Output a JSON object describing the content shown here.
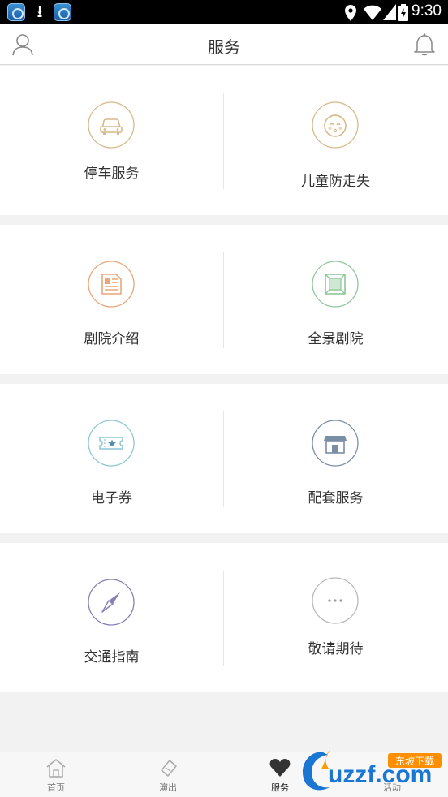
{
  "status_bar": {
    "time": "9:30",
    "icons": [
      "app-notification-icon",
      "download-icon",
      "app-notification-icon",
      "location-icon",
      "wifi-icon",
      "signal-icon",
      "battery-icon"
    ]
  },
  "header": {
    "title": "服务",
    "left_icon": "user-icon",
    "right_icon": "bell-icon"
  },
  "services": [
    {
      "label": "停车服务",
      "icon": "car-icon",
      "accent": "#d9b98a"
    },
    {
      "label": "儿童防走失",
      "icon": "baby-face-icon",
      "accent": "#d9b98a"
    },
    {
      "label": "剧院介绍",
      "icon": "document-icon",
      "accent": "#e9a678"
    },
    {
      "label": "全景剧院",
      "icon": "panorama-icon",
      "accent": "#8ec79a"
    },
    {
      "label": "电子券",
      "icon": "ticket-icon",
      "accent": "#8ec6d6"
    },
    {
      "label": "配套服务",
      "icon": "store-icon",
      "accent": "#7a8ea6"
    },
    {
      "label": "交通指南",
      "icon": "compass-icon",
      "accent": "#8a7fb5"
    },
    {
      "label": "敬请期待",
      "icon": "more-icon",
      "accent": "#b8b8b8"
    }
  ],
  "bottom_nav": [
    {
      "label": "首页",
      "icon": "home-icon",
      "active": false
    },
    {
      "label": "演出",
      "icon": "ticket-stub-icon",
      "active": false
    },
    {
      "label": "服务",
      "icon": "heart-icon",
      "active": true
    },
    {
      "label": "活动",
      "icon": "activity-icon",
      "active": false
    }
  ],
  "watermark": {
    "brand": "uzzf.com",
    "tag": "东坡下载"
  }
}
